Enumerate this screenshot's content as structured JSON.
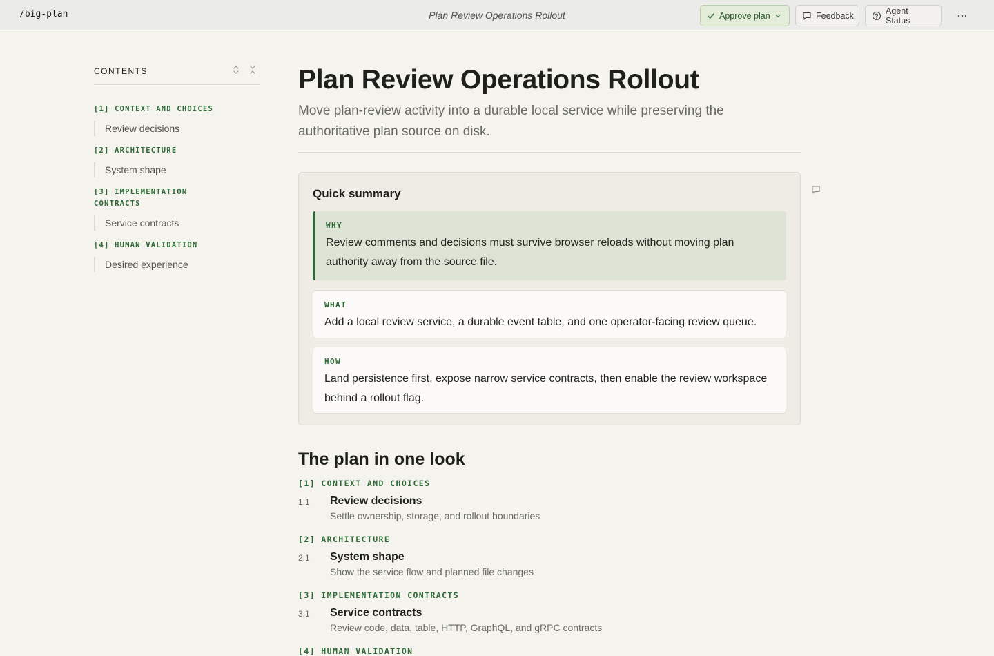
{
  "topbar": {
    "app_name": "/big-plan",
    "doc_title": "Plan Review Operations Rollout",
    "approve_label": "Approve plan",
    "feedback_label": "Feedback",
    "agent_label": "Agent Status"
  },
  "sidebar": {
    "title": "CONTENTS",
    "sections": [
      {
        "label": "[1] CONTEXT AND CHOICES",
        "sub": "Review decisions"
      },
      {
        "label": "[2] ARCHITECTURE",
        "sub": "System shape"
      },
      {
        "label": "[3] IMPLEMENTATION CONTRACTS",
        "sub": "Service contracts"
      },
      {
        "label": "[4] HUMAN VALIDATION",
        "sub": "Desired experience"
      }
    ]
  },
  "main": {
    "title": "Plan Review Operations Rollout",
    "subtitle": "Move plan-review activity into a durable local service while preserving the authoritative plan source on disk.",
    "summary": {
      "title": "Quick summary",
      "why": {
        "label": "WHY",
        "text": "Review comments and decisions must survive browser reloads without moving plan authority away from the source file."
      },
      "what": {
        "label": "WHAT",
        "text": "Add a local review service, a durable event table, and one operator-facing review queue."
      },
      "how": {
        "label": "HOW",
        "text": "Land persistence first, expose narrow service contracts, then enable the review workspace behind a rollout flag."
      }
    },
    "plan": {
      "title": "The plan in one look",
      "sections": [
        {
          "label": "[1] CONTEXT AND CHOICES",
          "num": "1.1",
          "item_title": "Review decisions",
          "item_desc": "Settle ownership, storage, and rollout boundaries"
        },
        {
          "label": "[2] ARCHITECTURE",
          "num": "2.1",
          "item_title": "System shape",
          "item_desc": "Show the service flow and planned file changes"
        },
        {
          "label": "[3] IMPLEMENTATION CONTRACTS",
          "num": "3.1",
          "item_title": "Service contracts",
          "item_desc": "Review code, data, table, HTTP, GraphQL, and gRPC contracts"
        },
        {
          "label": "[4] HUMAN VALIDATION"
        }
      ]
    }
  }
}
